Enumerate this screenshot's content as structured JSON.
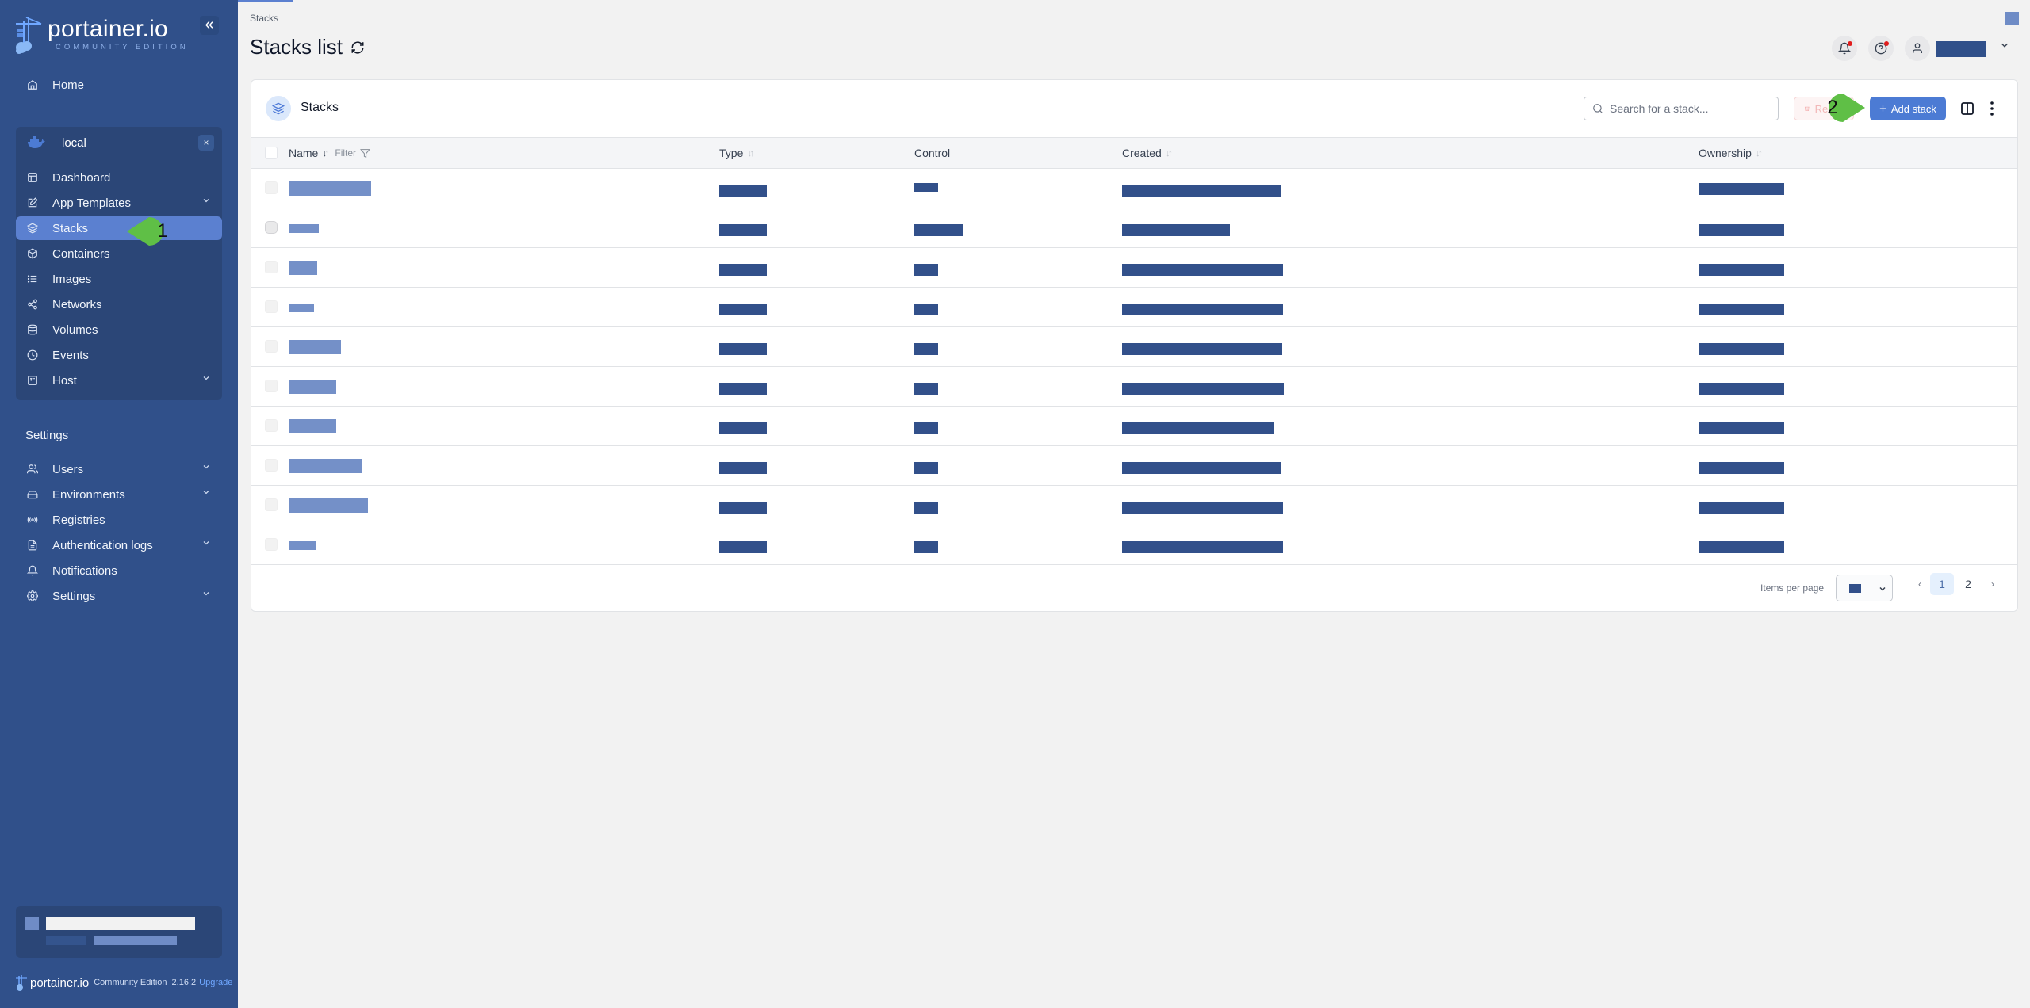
{
  "app": {
    "brand": "portainer.io",
    "edition_tagline": "COMMUNITY EDITION",
    "collapse_label": "«"
  },
  "sidebar": {
    "home_label": "Home",
    "environment": {
      "name": "local",
      "icon": "docker-icon",
      "close_label": "×"
    },
    "env_items": [
      {
        "label": "Dashboard",
        "icon": "dashboard-icon",
        "expandable": false,
        "active": false
      },
      {
        "label": "App Templates",
        "icon": "edit-icon",
        "expandable": true,
        "active": false
      },
      {
        "label": "Stacks",
        "icon": "layers-icon",
        "expandable": false,
        "active": true
      },
      {
        "label": "Containers",
        "icon": "box-icon",
        "expandable": false,
        "active": false
      },
      {
        "label": "Images",
        "icon": "list-icon",
        "expandable": false,
        "active": false
      },
      {
        "label": "Networks",
        "icon": "share-icon",
        "expandable": false,
        "active": false
      },
      {
        "label": "Volumes",
        "icon": "database-icon",
        "expandable": false,
        "active": false
      },
      {
        "label": "Events",
        "icon": "clock-icon",
        "expandable": false,
        "active": false
      },
      {
        "label": "Host",
        "icon": "host-icon",
        "expandable": true,
        "active": false
      }
    ],
    "settings_title": "Settings",
    "settings_items": [
      {
        "label": "Users",
        "icon": "users-icon",
        "expandable": true
      },
      {
        "label": "Environments",
        "icon": "hard-drive-icon",
        "expandable": true
      },
      {
        "label": "Registries",
        "icon": "radio-icon",
        "expandable": false
      },
      {
        "label": "Authentication logs",
        "icon": "file-text-icon",
        "expandable": true
      },
      {
        "label": "Notifications",
        "icon": "bell-icon",
        "expandable": false
      },
      {
        "label": "Settings",
        "icon": "gear-icon",
        "expandable": true
      }
    ],
    "footer": {
      "brand": "portainer.io",
      "edition": "Community Edition",
      "version": "2.16.2",
      "upgrade_label": "Upgrade"
    }
  },
  "header": {
    "breadcrumb": "Stacks",
    "title": "Stacks list",
    "notifications_has_alert": true,
    "help_has_alert": true
  },
  "card": {
    "title": "Stacks",
    "search_placeholder": "Search for a stack...",
    "remove_label": "Remove",
    "add_label": "Add stack",
    "add_icon": "+"
  },
  "table": {
    "columns": [
      {
        "label": "Name",
        "sortable": true,
        "sorted": "desc",
        "filter_label": "Filter"
      },
      {
        "label": "Type",
        "sortable": true
      },
      {
        "label": "Control",
        "sortable": false
      },
      {
        "label": "Created",
        "sortable": true
      },
      {
        "label": "Ownership",
        "sortable": true
      }
    ],
    "rows": [
      {
        "name": "[redacted]",
        "type": "[redacted]",
        "control": "[redacted]",
        "created": "[redacted]",
        "ownership": "[redacted]"
      },
      {
        "name": "[redacted]",
        "type": "[redacted]",
        "control": "[redacted]",
        "created": "[redacted]",
        "ownership": "[redacted]"
      },
      {
        "name": "[redacted]",
        "type": "[redacted]",
        "control": "[redacted]",
        "created": "[redacted]",
        "ownership": "[redacted]"
      },
      {
        "name": "[redacted]",
        "type": "[redacted]",
        "control": "[redacted]",
        "created": "[redacted]",
        "ownership": "[redacted]"
      },
      {
        "name": "[redacted]",
        "type": "[redacted]",
        "control": "[redacted]",
        "created": "[redacted]",
        "ownership": "[redacted]"
      },
      {
        "name": "[redacted]",
        "type": "[redacted]",
        "control": "[redacted]",
        "created": "[redacted]",
        "ownership": "[redacted]"
      },
      {
        "name": "[redacted]",
        "type": "[redacted]",
        "control": "[redacted]",
        "created": "[redacted]",
        "ownership": "[redacted]"
      },
      {
        "name": "[redacted]",
        "type": "[redacted]",
        "control": "[redacted]",
        "created": "[redacted]",
        "ownership": "[redacted]"
      },
      {
        "name": "[redacted]",
        "type": "[redacted]",
        "control": "[redacted]",
        "created": "[redacted]",
        "ownership": "[redacted]"
      },
      {
        "name": "[redacted]",
        "type": "[redacted]",
        "control": "[redacted]",
        "created": "[redacted]",
        "ownership": "[redacted]"
      }
    ]
  },
  "pagination": {
    "items_per_page_label": "Items per page",
    "items_per_page_value": "[redacted]",
    "prev_label": "‹",
    "next_label": "›",
    "pages": [
      "1",
      "2"
    ],
    "current_page": "1"
  },
  "annotations": [
    {
      "label": "1",
      "target": "Stacks sidebar item"
    },
    {
      "label": "2",
      "target": "Add stack button"
    }
  ],
  "colors": {
    "sidebar_bg": "#30508a",
    "sidebar_active": "#5b80d0",
    "primary": "#4c7bd4",
    "callout": "#5fbf46",
    "alert_dot": "#e11d1d"
  }
}
